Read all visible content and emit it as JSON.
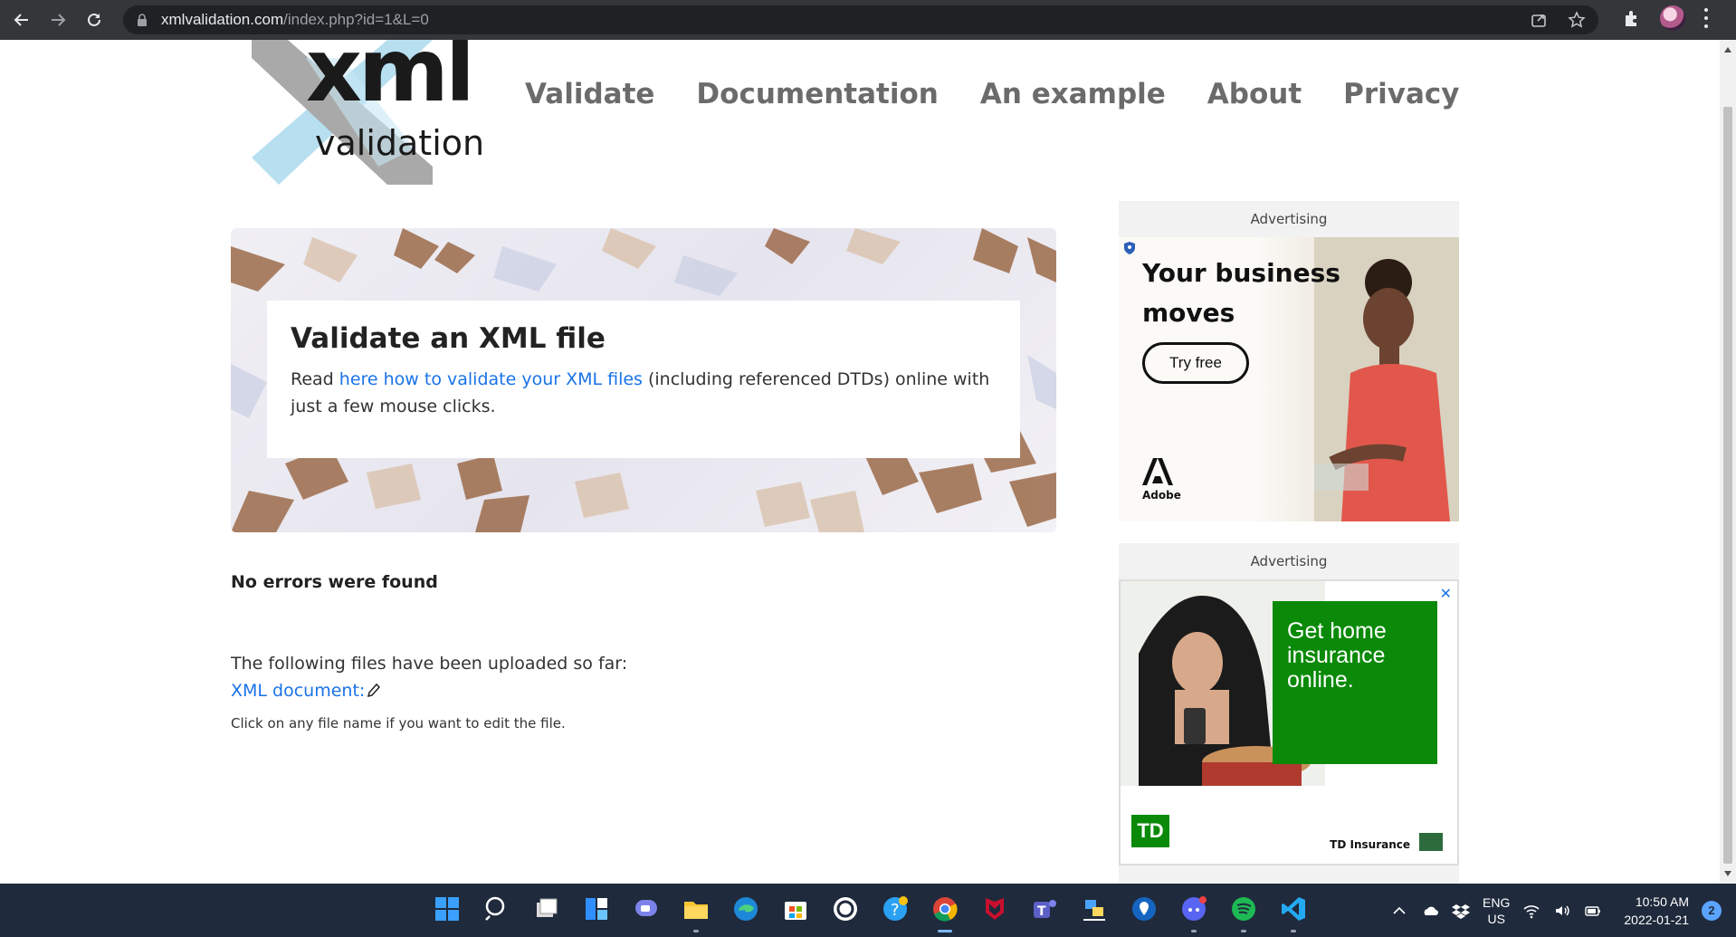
{
  "browser": {
    "url_host": "xmlvalidation.com",
    "url_path": "/index.php?id=1&L=0"
  },
  "logo": {
    "main": "xml",
    "sub": "validation"
  },
  "nav": {
    "items": [
      "Validate",
      "Documentation",
      "An example",
      "About",
      "Privacy"
    ]
  },
  "hero": {
    "title": "Validate an XML file",
    "text_before": "Read ",
    "link": "here how to validate your XML files",
    "text_after": " (including referenced DTDs) online with just a few mouse clicks."
  },
  "result": {
    "message": "No errors were found"
  },
  "files": {
    "heading": "The following files have been uploaded so far:",
    "link": "XML document:",
    "hint": "Click on any file name if you want to edit the file."
  },
  "ads": [
    {
      "label": "Advertising",
      "headline": "Your business moves",
      "cta": "Try free",
      "brand": "Adobe"
    },
    {
      "label": "Advertising",
      "headline": "Get home insurance online.",
      "brand_logo": "TD",
      "brand": "TD Insurance"
    }
  ],
  "taskbar": {
    "lang_line1": "ENG",
    "lang_line2": "US",
    "time": "10:50 AM",
    "date": "2022-01-21",
    "notifications": "2"
  },
  "colors": {
    "link": "#1a73e8",
    "nav": "#6b6b6b",
    "td_green": "#0a8a08",
    "taskbar": "#1f2a3c"
  }
}
